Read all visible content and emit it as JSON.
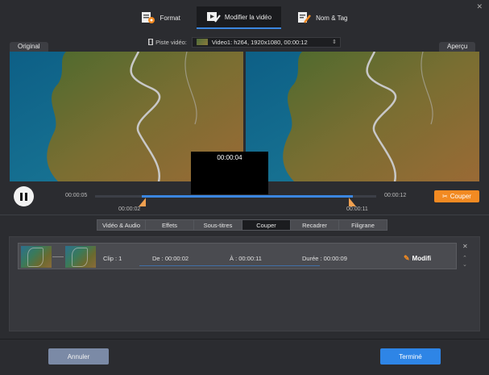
{
  "window": {
    "close_glyph": "✕"
  },
  "top_tabs": [
    {
      "label": "Format",
      "icon": "format-icon",
      "active": false
    },
    {
      "label": "Modifier la vidéo",
      "icon": "edit-video-icon",
      "active": true
    },
    {
      "label": "Nom & Tag",
      "icon": "name-tag-icon",
      "active": false
    }
  ],
  "track": {
    "label": "Piste vidéo:",
    "value": "Video1: h264, 1920x1080, 00:00:12"
  },
  "preview": {
    "original_label": "Original",
    "preview_label": "Aperçu",
    "popup_time": "00:00:04"
  },
  "player": {
    "current_time": "00:00:05",
    "total_time": "00:00:12",
    "start_marker": "00:00:02",
    "end_marker": "00:00:11",
    "selection_start_fraction": 0.1667,
    "selection_end_fraction": 0.9167,
    "cut_label": "Couper"
  },
  "sub_tabs": [
    {
      "label": "Vidéo  & Audio",
      "active": false
    },
    {
      "label": "Effets",
      "active": false
    },
    {
      "label": "Sous-titres",
      "active": false
    },
    {
      "label": "Couper",
      "active": true
    },
    {
      "label": "Recadrer",
      "active": false
    },
    {
      "label": "Filigrane",
      "active": false
    }
  ],
  "clip": {
    "clip_label": "Clip : 1",
    "from": "De :  00:00:02",
    "to": "À :  00:00:11",
    "duration": "Durée : 00:00:09",
    "modify_label": "Modifi"
  },
  "footer": {
    "cancel_label": "Annuler",
    "done_label": "Terminé"
  },
  "colors": {
    "accent_blue": "#3b86e0",
    "cut_orange": "#f28a22",
    "cancel_button": "#7b8aa6",
    "done_button": "#2e85e6"
  }
}
